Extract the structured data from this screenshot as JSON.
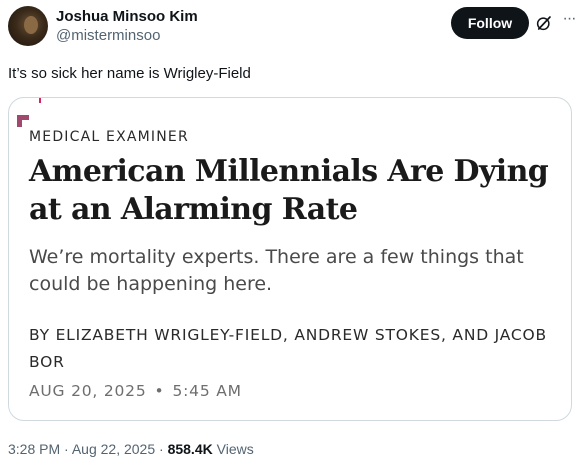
{
  "author": {
    "display_name": "Joshua Minsoo Kim",
    "handle": "@misterminsoo",
    "avatar_icon": "avatar-photo"
  },
  "actions": {
    "follow_label": "Follow",
    "grok_icon": "grok-icon",
    "more_icon": "more-dots-icon"
  },
  "tweet": {
    "text": "It’s so sick her name is Wrigley-Field"
  },
  "card": {
    "kicker": "MEDICAL EXAMINER",
    "headline": "American Millennials Are Dying at an Alarming Rate",
    "dek": "We’re mortality experts. There are a few things that could be happening here.",
    "byline": "BY ELIZABETH WRIGLEY-FIELD, ANDREW STOKES, AND JACOB BOR",
    "date": "AUG 20, 2025",
    "separator": "•",
    "time": "5:45 AM",
    "accent_color": "#a0486e"
  },
  "meta": {
    "time": "3:28 PM",
    "dot1": "·",
    "date": "Aug 22, 2025",
    "dot2": "·",
    "views_count": "858.4K",
    "views_label": "Views"
  }
}
